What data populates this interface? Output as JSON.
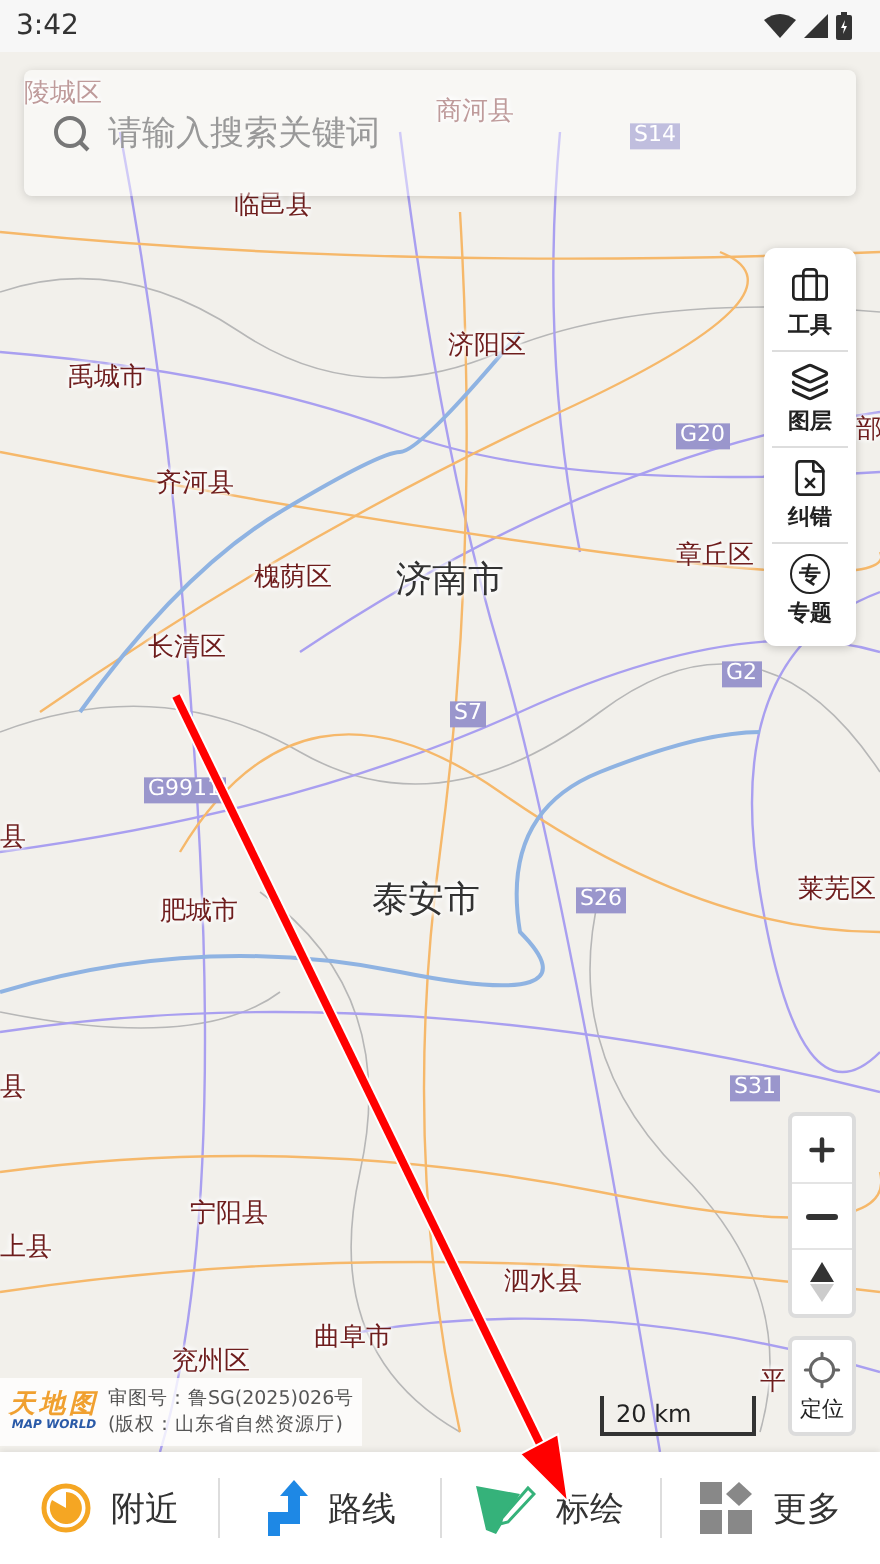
{
  "status_bar": {
    "time": "3:42"
  },
  "search": {
    "placeholder": "请输入搜索关键词"
  },
  "map": {
    "labels": [
      {
        "text": "陵城区",
        "kind": "faded"
      },
      {
        "text": "商河县",
        "kind": "faded"
      },
      {
        "text": "S14",
        "kind": "faded_road"
      },
      {
        "text": "临邑县",
        "kind": "place"
      },
      {
        "text": "济阳区",
        "kind": "place"
      },
      {
        "text": "禹城市",
        "kind": "place"
      },
      {
        "text": "G20",
        "kind": "road"
      },
      {
        "text": "部",
        "kind": "place"
      },
      {
        "text": "齐河县",
        "kind": "place"
      },
      {
        "text": "章丘区",
        "kind": "place"
      },
      {
        "text": "槐荫区",
        "kind": "place"
      },
      {
        "text": "济南市",
        "kind": "city"
      },
      {
        "text": "长清区",
        "kind": "place"
      },
      {
        "text": "G2",
        "kind": "road"
      },
      {
        "text": "S7",
        "kind": "road"
      },
      {
        "text": "G9911",
        "kind": "road"
      },
      {
        "text": "县",
        "kind": "place"
      },
      {
        "text": "泰安市",
        "kind": "city"
      },
      {
        "text": "S26",
        "kind": "road"
      },
      {
        "text": "莱芜区",
        "kind": "place"
      },
      {
        "text": "肥城市",
        "kind": "place"
      },
      {
        "text": "县",
        "kind": "place"
      },
      {
        "text": "S31",
        "kind": "road"
      },
      {
        "text": "宁阳县",
        "kind": "place"
      },
      {
        "text": "上县",
        "kind": "place"
      },
      {
        "text": "泗水县",
        "kind": "place"
      },
      {
        "text": "曲阜市",
        "kind": "place"
      },
      {
        "text": "兖州区",
        "kind": "place"
      },
      {
        "text": "平",
        "kind": "place"
      }
    ]
  },
  "tools": [
    {
      "label": "工具",
      "kind": "toolbox"
    },
    {
      "label": "图层",
      "kind": "layers"
    },
    {
      "label": "纠错",
      "kind": "report"
    },
    {
      "label": "专题",
      "kind": "topic",
      "glyph": "专"
    }
  ],
  "locate": {
    "label": "定位"
  },
  "scale": {
    "label": "20 km"
  },
  "attribution": {
    "logo": "天地图",
    "logo_subtitle": "MAP WORLD",
    "lines": [
      "审图号：鲁SG(2025)026号",
      "(版权：山东省自然资源厅)"
    ]
  },
  "bottom_nav": [
    {
      "label": "附近",
      "kind": "nearby"
    },
    {
      "label": "路线",
      "kind": "route"
    },
    {
      "label": "标绘",
      "kind": "draw"
    },
    {
      "label": "更多",
      "kind": "more"
    }
  ]
}
